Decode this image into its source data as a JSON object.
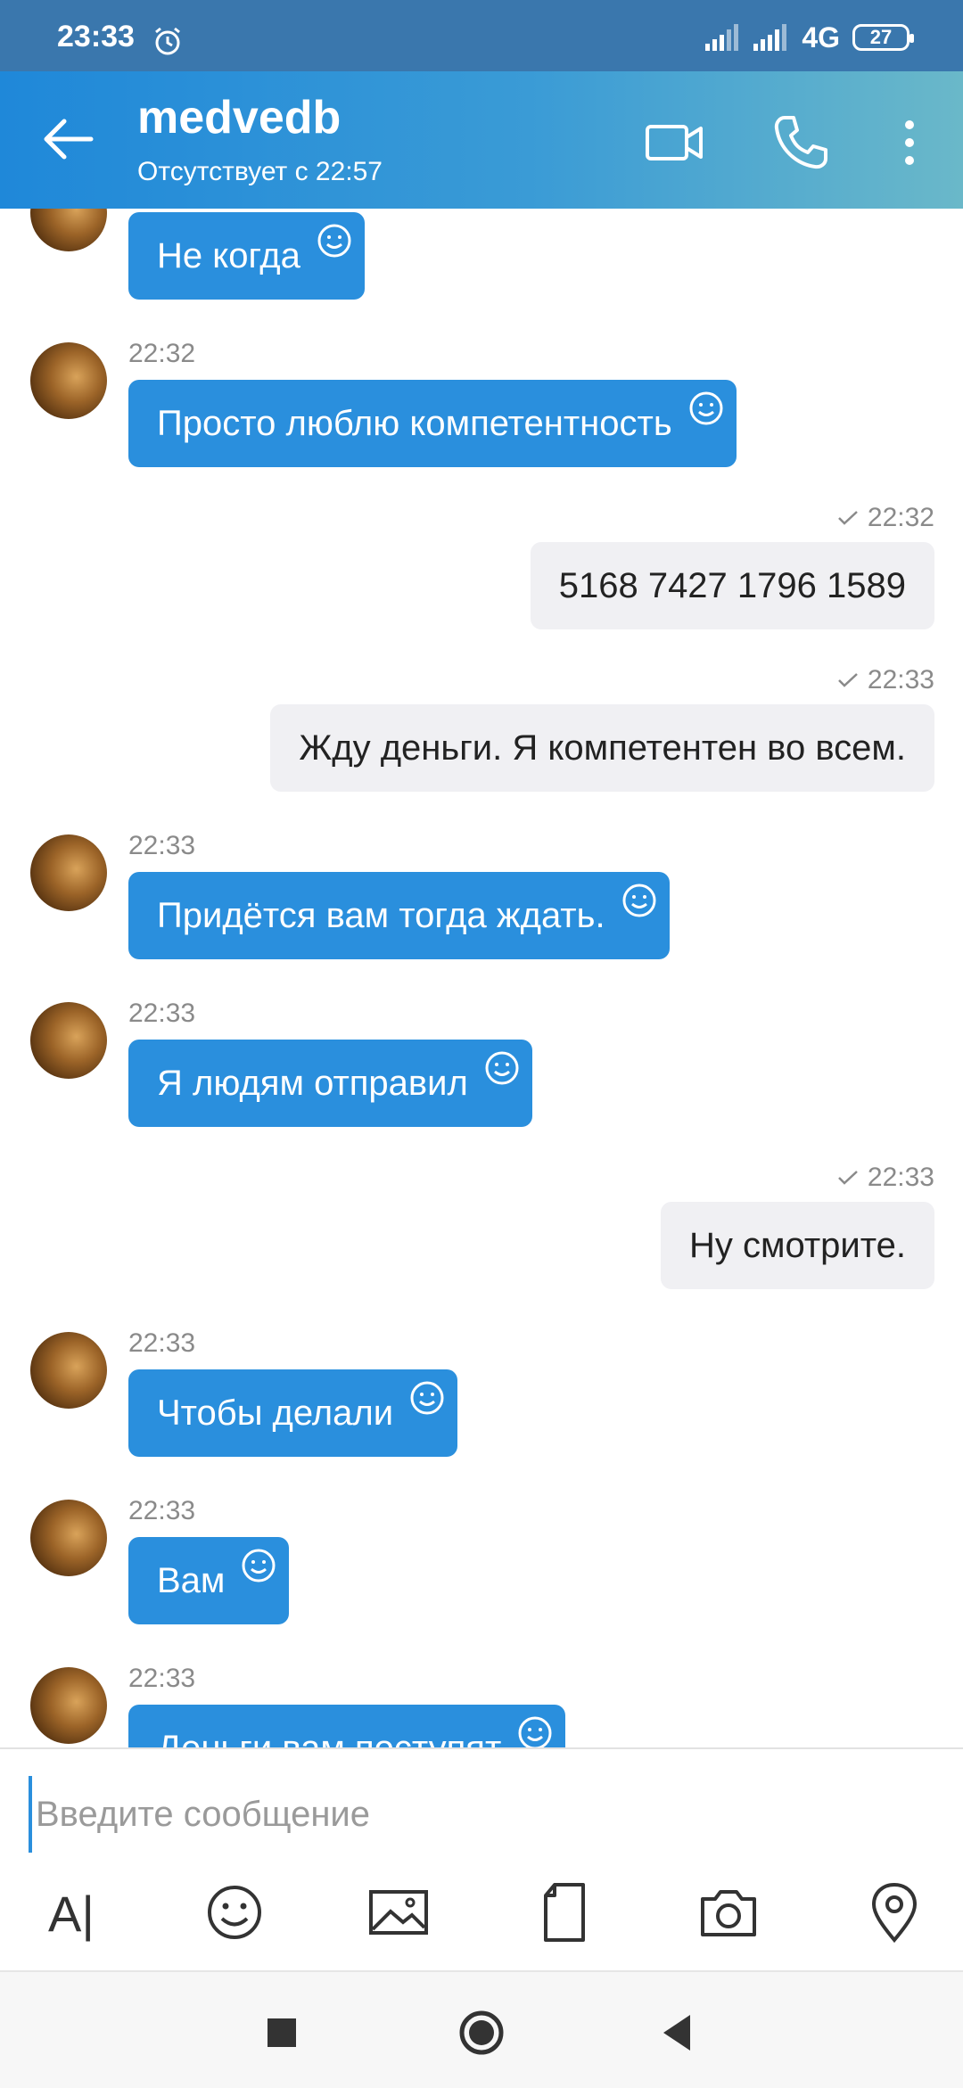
{
  "status_bar": {
    "time": "23:33",
    "network": "4G",
    "battery": "27"
  },
  "header": {
    "title": "medvedb",
    "status": "Отсутствует с 22:57"
  },
  "messages": [
    {
      "dir": "in",
      "time": "",
      "text": "Не когда"
    },
    {
      "dir": "in",
      "time": "22:32",
      "text": "Просто люблю компетентность"
    },
    {
      "dir": "out",
      "time": "22:32",
      "text": "5168 7427 1796 1589"
    },
    {
      "dir": "out",
      "time": "22:33",
      "text": "Жду деньги. Я компетентен во всем."
    },
    {
      "dir": "in",
      "time": "22:33",
      "text": "Придётся вам тогда ждать."
    },
    {
      "dir": "in",
      "time": "22:33",
      "text": "Я людям отправил"
    },
    {
      "dir": "out",
      "time": "22:33",
      "text": "Ну смотрите."
    },
    {
      "dir": "in",
      "time": "22:33",
      "text": "Чтобы делали"
    },
    {
      "dir": "in",
      "time": "22:33",
      "text": "Вам"
    },
    {
      "dir": "in",
      "time": "22:33",
      "text": "Деньги вам поступят"
    }
  ],
  "composer": {
    "placeholder": "Введите сообщение",
    "text_tool_label": "A|"
  },
  "colors": {
    "accent": "#2a8fdd",
    "outgoing_bubble": "#f0f0f3",
    "appbar": "#1f88d9"
  }
}
